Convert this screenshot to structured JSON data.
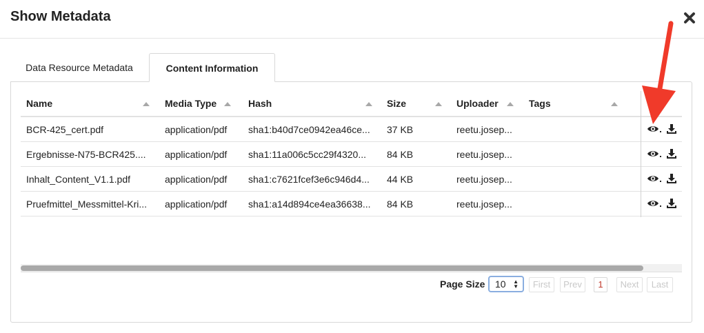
{
  "dialog": {
    "title": "Show Metadata",
    "close_icon": "close-icon"
  },
  "tabs": [
    {
      "label": "Data Resource Metadata",
      "active": false
    },
    {
      "label": "Content Information",
      "active": true
    }
  ],
  "table": {
    "columns": [
      "Name",
      "Media Type",
      "Hash",
      "Size",
      "Uploader",
      "Tags"
    ],
    "rows": [
      {
        "name": "BCR-425_cert.pdf",
        "media_type": "application/pdf",
        "hash": "sha1:b40d7ce0942ea46ce...",
        "size": "37 KB",
        "uploader": "reetu.josep...",
        "tags": ""
      },
      {
        "name": "Ergebnisse-N75-BCR425....",
        "media_type": "application/pdf",
        "hash": "sha1:11a006c5cc29f4320...",
        "size": "84 KB",
        "uploader": "reetu.josep...",
        "tags": ""
      },
      {
        "name": "Inhalt_Content_V1.1.pdf",
        "media_type": "application/pdf",
        "hash": "sha1:c7621fcef3e6c946d4...",
        "size": "44 KB",
        "uploader": "reetu.josep...",
        "tags": ""
      },
      {
        "name": "Pruefmittel_Messmittel-Kri...",
        "media_type": "application/pdf",
        "hash": "sha1:a14d894ce4ea36638...",
        "size": "84 KB",
        "uploader": "reetu.josep...",
        "tags": ""
      }
    ],
    "row_actions": [
      "eye-icon",
      "download-icon"
    ],
    "horizontal_scroll_fraction": 0.94
  },
  "pager": {
    "page_size_label": "Page Size",
    "page_size_value": "10",
    "first": "First",
    "prev": "Prev",
    "current_page": "1",
    "next": "Next",
    "last": "Last"
  },
  "colors": {
    "annotation_arrow": "#f03a2a",
    "current_page": "#c0392b",
    "select_focus": "#8aaee0"
  }
}
